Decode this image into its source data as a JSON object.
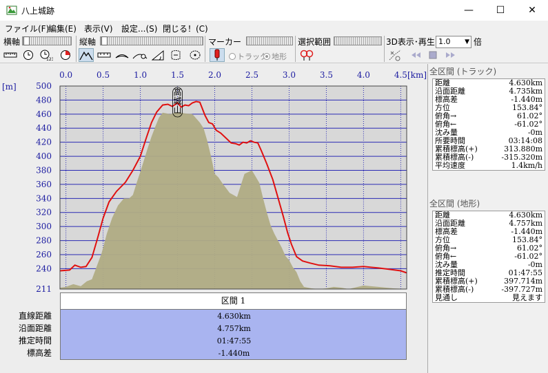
{
  "window": {
    "title": "八上城跡",
    "minimize_glyph": "—",
    "maximize_glyph": "☐",
    "close_glyph": "✕"
  },
  "menu": [
    "ファイル(F)",
    "編集(E)",
    "表示(V)",
    "設定...(S)",
    "閉じる！(C)"
  ],
  "toolbar": {
    "yoko_label": "横軸",
    "tate_label": "縦軸",
    "marker_label": "マーカー",
    "sentaku_label": "選択範囲",
    "view3d_label": "3D表示･再生",
    "radio_track": "トラック",
    "radio_terrain": "地形",
    "speed_value": "1.0",
    "speed_unit": "倍"
  },
  "chart_data": {
    "type": "area",
    "x_unit": "[km]",
    "y_unit": "[m]",
    "xlim": [
      -0.08,
      4.58
    ],
    "ylim": [
      211,
      500
    ],
    "x_ticks": [
      "0.0",
      "0.5",
      "1.0",
      "1.5",
      "2.0",
      "2.5",
      "3.0",
      "3.5",
      "4.0",
      "4.5"
    ],
    "x_tick_values": [
      0,
      0.5,
      1.0,
      1.5,
      2.0,
      2.5,
      3.0,
      3.5,
      4.0,
      4.5
    ],
    "y_ticks": [
      "500",
      "480",
      "460",
      "440",
      "420",
      "400",
      "380",
      "360",
      "340",
      "320",
      "300",
      "280",
      "260",
      "240",
      "211"
    ],
    "y_tick_values": [
      500,
      480,
      460,
      440,
      420,
      400,
      380,
      360,
      340,
      320,
      300,
      280,
      260,
      240,
      211
    ],
    "summit_label": "高城山",
    "series": [
      {
        "name": "トラック",
        "color": "#e01010",
        "x": [
          -0.08,
          0.05,
          0.12,
          0.2,
          0.27,
          0.35,
          0.43,
          0.5,
          0.58,
          0.68,
          0.8,
          0.9,
          1.0,
          1.08,
          1.15,
          1.22,
          1.3,
          1.37,
          1.43,
          1.5,
          1.55,
          1.6,
          1.65,
          1.7,
          1.75,
          1.8,
          1.87,
          1.92,
          1.97,
          2.02,
          2.08,
          2.15,
          2.22,
          2.28,
          2.33,
          2.38,
          2.43,
          2.48,
          2.53,
          2.58,
          2.63,
          2.7,
          2.78,
          2.85,
          2.92,
          2.98,
          3.03,
          3.1,
          3.18,
          3.28,
          3.4,
          3.55,
          3.7,
          3.85,
          4.0,
          4.1,
          4.2,
          4.35,
          4.5,
          4.58
        ],
        "y": [
          237,
          238,
          245,
          242,
          243,
          256,
          285,
          312,
          335,
          350,
          363,
          380,
          400,
          426,
          448,
          463,
          473,
          474,
          471,
          476,
          470,
          473,
          472,
          476,
          478,
          477,
          458,
          448,
          446,
          437,
          433,
          426,
          419,
          418,
          416,
          420,
          419,
          422,
          420,
          419,
          407,
          389,
          367,
          341,
          315,
          291,
          275,
          257,
          251,
          248,
          245,
          244,
          242,
          242,
          243,
          242,
          241,
          239,
          237,
          234
        ]
      },
      {
        "name": "地形",
        "color": "#b0ac84",
        "x": [
          -0.08,
          0.0,
          0.1,
          0.2,
          0.28,
          0.35,
          0.42,
          0.48,
          0.55,
          0.62,
          0.7,
          0.78,
          0.85,
          0.9,
          0.95,
          1.0,
          1.05,
          1.1,
          1.15,
          1.2,
          1.25,
          1.3,
          1.4,
          1.5,
          1.6,
          1.7,
          1.8,
          1.85,
          1.9,
          1.95,
          2.0,
          2.05,
          2.1,
          2.15,
          2.2,
          2.3,
          2.4,
          2.5,
          2.6,
          2.65,
          2.7,
          2.75,
          2.8,
          2.85,
          2.9,
          2.95,
          3.0,
          3.05,
          3.1,
          3.15,
          3.2,
          3.3,
          3.4,
          3.5,
          3.6,
          3.7,
          3.8,
          4.0,
          4.2,
          4.4,
          4.58
        ],
        "y": [
          213,
          214,
          218,
          215,
          222,
          225,
          245,
          262,
          290,
          312,
          330,
          340,
          340,
          345,
          362,
          378,
          395,
          412,
          428,
          442,
          455,
          462,
          460,
          463,
          461,
          460,
          448,
          440,
          422,
          400,
          375,
          370,
          362,
          355,
          348,
          342,
          375,
          380,
          362,
          340,
          320,
          302,
          290,
          280,
          270,
          258,
          252,
          242,
          235,
          222,
          214,
          212,
          211,
          212,
          214,
          213,
          211,
          216,
          214,
          212,
          211
        ]
      }
    ]
  },
  "summary": {
    "header": "区間 1",
    "labels": [
      "直線距離",
      "沿面距離",
      "推定時間",
      "標高差"
    ],
    "values": [
      "4.630km",
      "4.757km",
      "01:47:55",
      "-1.440m"
    ]
  },
  "track_section": {
    "title": "全区間 (トラック)",
    "rows": [
      {
        "k": "距離",
        "v": "4.630km"
      },
      {
        "k": "沿面距離",
        "v": "4.735km"
      },
      {
        "k": "標高差",
        "v": "-1.440m"
      },
      {
        "k": "方位",
        "v": "153.84°"
      },
      {
        "k": "俯角→",
        "v": "61.02°"
      },
      {
        "k": "俯角←",
        "v": "-61.02°"
      },
      {
        "k": "沈み量",
        "v": "-0m"
      },
      {
        "k": "所要時間",
        "v": "03:14:08"
      },
      {
        "k": "累積標高(+)",
        "v": "313.880m"
      },
      {
        "k": "累積標高(-)",
        "v": "-315.320m"
      },
      {
        "k": "平均速度",
        "v": "1.4km/h"
      }
    ]
  },
  "terrain_section": {
    "title": "全区間 (地形)",
    "rows": [
      {
        "k": "距離",
        "v": "4.630km"
      },
      {
        "k": "沿面距離",
        "v": "4.757km"
      },
      {
        "k": "標高差",
        "v": "-1.440m"
      },
      {
        "k": "方位",
        "v": "153.84°"
      },
      {
        "k": "俯角→",
        "v": "61.02°"
      },
      {
        "k": "俯角←",
        "v": "-61.02°"
      },
      {
        "k": "沈み量",
        "v": "-0m"
      },
      {
        "k": "推定時間",
        "v": "01:47:55"
      },
      {
        "k": "累積標高(+)",
        "v": "397.714m"
      },
      {
        "k": "累積標高(-)",
        "v": "-397.727m"
      },
      {
        "k": "見通し",
        "v": "見えます"
      }
    ]
  },
  "colors": {
    "plot_bg": "#d8d8d8",
    "grid": "#2828b4",
    "track": "#e01010",
    "terrain": "#b0ac84",
    "summary_bg": "#a9b4f0"
  }
}
